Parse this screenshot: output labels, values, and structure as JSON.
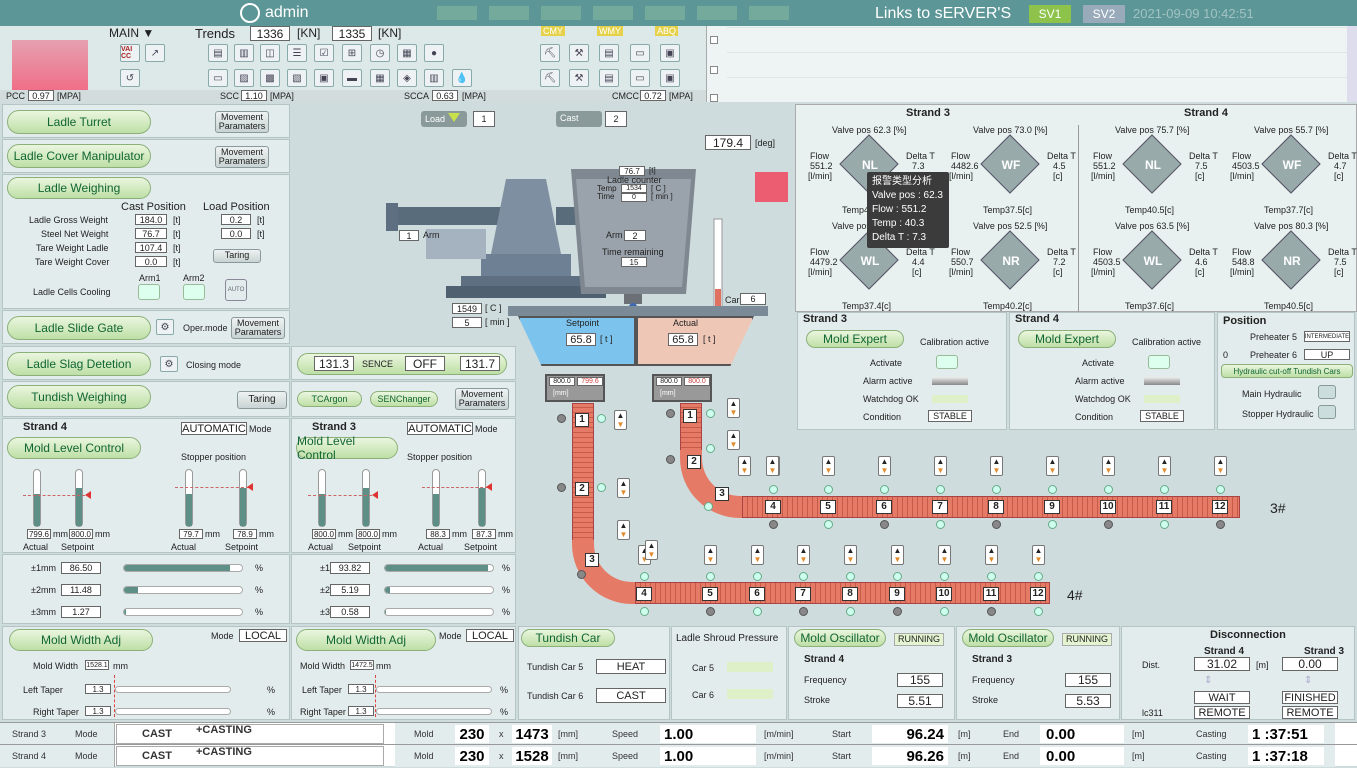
{
  "header": {
    "user": "admin",
    "links": "Links to sERVER'S",
    "sv1": "SV1",
    "sv2": "SV2",
    "datetime": "2021-09-09 10:42:51"
  },
  "toolbar": {
    "main": "MAIN ▼",
    "trends": "Trends",
    "trend1": "1336",
    "trend2": "1335",
    "unit": "[KN]",
    "cmy": "CMY",
    "wmy": "WMY",
    "abq": "ABQ",
    "vai": "VAI CC",
    "pcc_l": "PCC",
    "pcc": "0.97",
    "scc_l": "SCC",
    "scc": "1.10",
    "scca_l": "SCCA",
    "scca": "0.63",
    "cmcc_l": "CMCC",
    "cmcc": "0.72",
    "mpa": "[MPA]"
  },
  "left": {
    "ladle_turret": "Ladle Turret",
    "ladle_cover": "Ladle Cover Manipulator",
    "ladle_weighing": "Ladle Weighing",
    "movement": "Movement Paramaters",
    "cast_pos": "Cast Position",
    "load_pos": "Load Position",
    "rows": [
      {
        "l": "Ladle Gross Weight",
        "c": "184.0",
        "d": "0.2"
      },
      {
        "l": "Steel Net Weight",
        "c": "76.7",
        "d": "0.0"
      },
      {
        "l": "Tare Weight Ladle",
        "c": "107.4",
        "d": ""
      },
      {
        "l": "Tare Weight Cover",
        "c": "0.0",
        "d": ""
      }
    ],
    "t": "[t]",
    "taring": "Taring",
    "arm1": "Arm1",
    "arm2": "Arm2",
    "cells": "Ladle Cells Cooling",
    "auto": "AUTO",
    "slide_gate": "Ladle Slide Gate",
    "oper_mode": "Oper.mode",
    "slag": "Ladle Slag Detetion",
    "closing": "Closing mode",
    "tundish_w": "Tundish Weighing"
  },
  "center": {
    "load": "Load",
    "load_v": "1",
    "cast": "Cast",
    "cast_v": "2",
    "deg": "179.4",
    "deg_u": "[deg]",
    "arm": "Arm",
    "arm1": "1",
    "arm2": "2",
    "ladle_v": "76.7",
    "ladle_counter": "Ladle counter",
    "temp_l": "Temp",
    "temp": "1534",
    "temp_u": "[ C ]",
    "time_l": "Time",
    "time": "0",
    "time_u": "[ min ]",
    "time_rem": "Time remaining",
    "time_rem_v": "15",
    "tund_temp": "1549",
    "tund_temp_u": "[ C ]",
    "tund_min": "5",
    "tund_min_u": "[ min ]",
    "car_l": "Car",
    "car": "6",
    "setpoint": "Setpoint",
    "actual": "Actual",
    "sp_v": "65.8",
    "act_v": "65.8",
    "t": "[ t ]",
    "sm": "[mm]",
    "s4sp": "800.0",
    "s4ac": "799.6",
    "s3sp": "800.0",
    "s3ac": "800.0",
    "sence1": "131.3",
    "sence": "SENCE",
    "off": "OFF",
    "sence2": "131.7",
    "tcargon": "TCArgon",
    "senchanger": "SENChanger",
    "s3": "3#",
    "s4": "4#"
  },
  "mold4": {
    "title": "Strand 4",
    "mode": "AUTOMATIC",
    "mode_l": "Mode",
    "mlc": "Mold Level Control",
    "stopper": "Stopper position",
    "a1": "799.6",
    "s1": "800.0",
    "a2": "79.7",
    "s2": "78.9",
    "mm": "mm",
    "actual": "Actual",
    "setpoint": "Setpoint",
    "r1": "86.50",
    "r2": "11.48",
    "r3": "1.27",
    "p1": 0.9,
    "p2": 0.12,
    "p3": 0.02
  },
  "mold3": {
    "title": "Strand 3",
    "mode": "AUTOMATIC",
    "mode_l": "Mode",
    "mlc": "Mold Level Control",
    "stopper": "Stopper position",
    "a1": "800.0",
    "s1": "800.0",
    "a2": "88.3",
    "s2": "87.3",
    "mm": "mm",
    "actual": "Actual",
    "setpoint": "Setpoint",
    "r1": "93.82",
    "r2": "5.19",
    "r3": "0.58",
    "p1": 0.95,
    "p2": 0.05,
    "p3": 0.01
  },
  "ranges": [
    "±1mm",
    "±2mm",
    "±3mm"
  ],
  "pct": "%",
  "width4": {
    "title": "Mold Width Adj",
    "mode_l": "Mode",
    "mode": "LOCAL",
    "mw_l": "Mold Width",
    "mw": "1528.1",
    "mm": "mm",
    "lt": "Left Taper",
    "rt": "Right Taper",
    "v": "1.3",
    "pct": "%"
  },
  "width3": {
    "title": "Mold Width Adj",
    "mode_l": "Mode",
    "mode": "LOCAL",
    "mw_l": "Mold Width",
    "mw": "1472.5",
    "mm": "mm",
    "lt": "Left Taper",
    "rt": "Right Taper",
    "v": "1.3",
    "pct": "%"
  },
  "tundish_car": {
    "title": "Tundish Car",
    "c5": "Tundish Car 5",
    "c5v": "HEAT",
    "c6": "Tundish Car 6",
    "c6v": "CAST"
  },
  "shroud": {
    "title": "Ladle Shroud Pressure",
    "c5": "Car 5",
    "c6": "Car 6"
  },
  "osc4": {
    "title": "Mold Oscillator",
    "status": "RUNNING",
    "strand": "Strand 4",
    "freq_l": "Frequency",
    "freq": "155",
    "stroke_l": "Stroke",
    "stroke": "5.51"
  },
  "osc3": {
    "title": "Mold Oscillator",
    "status": "RUNNING",
    "strand": "Strand 3",
    "freq_l": "Frequency",
    "freq": "155",
    "stroke_l": "Stroke",
    "stroke": "5.53"
  },
  "disc": {
    "title": "Disconnection",
    "s4": "Strand 4",
    "s3": "Strand 3",
    "dist": "Dist.",
    "d4": "31.02",
    "d3": "0.00",
    "m": "[m]",
    "st4": "WAIT",
    "st3": "FINISHED",
    "lc": "lc311",
    "r4": "REMOTE",
    "r3": "REMOTE"
  },
  "valves": {
    "s3": "Strand 3",
    "s4": "Strand 4",
    "vp": "Valve pos",
    "flow": "Flow",
    "flow_u": "[l/min]",
    "dt": "Delta T",
    "c": "[c]",
    "temp": "Temp",
    "pct": "[%]",
    "cells": [
      {
        "vp": "62.3",
        "f": "551.2",
        "d": "7.3",
        "t": "40.3",
        "n": "NL"
      },
      {
        "vp": "73.0",
        "f": "4482.6",
        "d": "4.5",
        "t": "37.5",
        "n": "WF"
      },
      {
        "vp": "75.7",
        "f": "551.2",
        "d": "7.5",
        "t": "40.5",
        "n": "NL"
      },
      {
        "vp": "55.7",
        "f": "4503.5",
        "d": "4.7",
        "t": "37.7",
        "n": "WF"
      },
      {
        "vp": "",
        "f": "4479.2",
        "d": "4.4",
        "t": "37.4",
        "n": "WL"
      },
      {
        "vp": "52.5",
        "f": "550.7",
        "d": "7.2",
        "t": "40.2",
        "n": "NR"
      },
      {
        "vp": "63.5",
        "f": "4503.5",
        "d": "4.6",
        "t": "37.6",
        "n": "WL"
      },
      {
        "vp": "80.3",
        "f": "548.8",
        "d": "7.5",
        "t": "40.5",
        "n": "NR"
      }
    ]
  },
  "tooltip": {
    "title": "报警类型分析",
    "l1": "Valve pos : 62.3",
    "l2": "Flow : 551.2",
    "l3": "Temp : 40.3",
    "l4": "Delta T : 7.3"
  },
  "expert": {
    "s3": "Strand 3",
    "s4": "Strand 4",
    "title": "Mold Expert",
    "calib": "Calibration active",
    "activate": "Activate",
    "alarm": "Alarm active",
    "watchdog": "Watchdog OK",
    "cond": "Condition",
    "stable": "STABLE"
  },
  "position": {
    "title": "Position",
    "p5": "Preheater 5",
    "p5v": "INTERMEDIATE",
    "zero": "0",
    "p6": "Preheater 6",
    "p6v": "UP",
    "hyd": "Hydraulic cut-off  Tundish Cars",
    "main": "Main Hydraulic",
    "stop": "Stopper Hydraulic"
  },
  "status": {
    "rows": [
      {
        "s": "Strand 3",
        "mode_l": "Mode",
        "mode": "CAST",
        "sub": "+CASTING",
        "mold_l": "Mold",
        "w": "230",
        "x": "x",
        "h": "1473",
        "mm": "[mm]",
        "sp_l": "Speed",
        "sp": "1.00",
        "spu": "[m/min]",
        "st_l": "Start",
        "st": "96.24",
        "m": "[m]",
        "en_l": "End",
        "en": "0.00",
        "cast_l": "Casting",
        "cast": "1 :37:51"
      },
      {
        "s": "Strand 4",
        "mode_l": "Mode",
        "mode": "CAST",
        "sub": "+CASTING",
        "mold_l": "Mold",
        "w": "230",
        "x": "x",
        "h": "1528",
        "mm": "[mm]",
        "sp_l": "Speed",
        "sp": "1.00",
        "spu": "[m/min]",
        "st_l": "Start",
        "st": "96.26",
        "m": "[m]",
        "en_l": "End",
        "en": "0.00",
        "cast_l": "Casting",
        "cast": "1 :37:18"
      }
    ]
  },
  "rollers3": [
    "4",
    "5",
    "6",
    "7",
    "8",
    "9",
    "10",
    "11",
    "12"
  ],
  "rollers4": [
    "4",
    "5",
    "6",
    "7",
    "8",
    "9",
    "10",
    "11",
    "12"
  ]
}
